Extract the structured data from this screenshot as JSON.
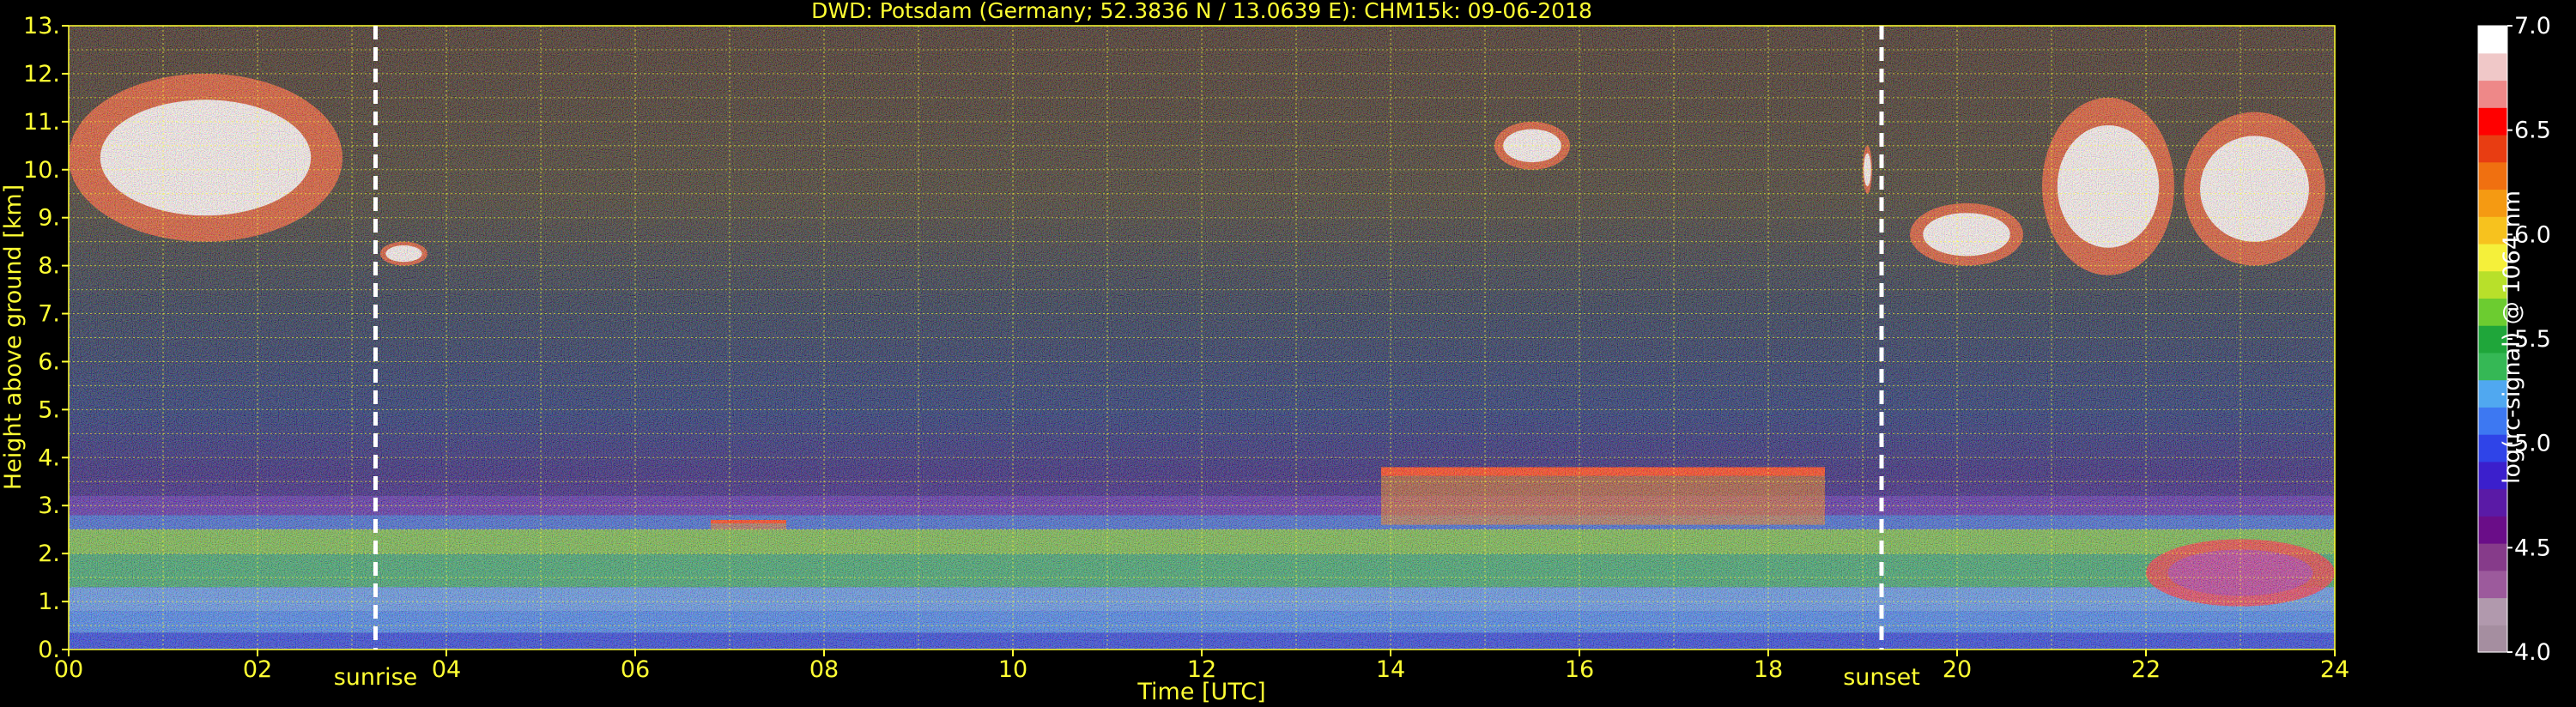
{
  "chart_data": {
    "type": "heatmap",
    "title": "DWD: Potsdam (Germany; 52.3836 N / 13.0639 E):    CHM15k: 09-06-2018",
    "xlabel": "Time [UTC]",
    "ylabel": "Height above ground [km]",
    "xlim": [
      0,
      24
    ],
    "ylim": [
      0,
      13
    ],
    "x_ticks": [
      "00",
      "02",
      "04",
      "06",
      "08",
      "10",
      "12",
      "14",
      "16",
      "18",
      "20",
      "22",
      "24"
    ],
    "y_ticks": [
      "0.",
      "1.",
      "2.",
      "3.",
      "4.",
      "5.",
      "6.",
      "7.",
      "8.",
      "9.",
      "10.",
      "11.",
      "12.",
      "13."
    ],
    "grid": true,
    "colorbar": {
      "label": "log(rc-signal) @ 1064 nm",
      "range": [
        4.0,
        7.0
      ],
      "ticks": [
        "4.0",
        "4.5",
        "5.0",
        "5.5",
        "6.0",
        "6.5",
        "7.0"
      ],
      "colors": [
        "#a58ea0",
        "#b199ad",
        "#9c5a9c",
        "#863b8a",
        "#6a0d88",
        "#5a1aa6",
        "#3b1fcc",
        "#2f44e8",
        "#3d78f2",
        "#50a8f0",
        "#35b855",
        "#1fa63a",
        "#6ccc30",
        "#b8e02a",
        "#f5f03a",
        "#f7c21e",
        "#f59a12",
        "#f07010",
        "#e83d12",
        "#ff0000",
        "#ee8888",
        "#f0c8c8",
        "#ffffff"
      ]
    },
    "annotations": [
      {
        "text": "sunrise",
        "x": 3.25
      },
      {
        "text": "sunset",
        "x": 19.2
      }
    ],
    "features": [
      {
        "kind": "cirrus",
        "x": [
          0.0,
          2.9
        ],
        "y": [
          8.5,
          12.0
        ]
      },
      {
        "kind": "cirrus",
        "x": [
          3.3,
          3.8
        ],
        "y": [
          8.0,
          8.5
        ]
      },
      {
        "kind": "cirrus",
        "x": [
          15.1,
          15.9
        ],
        "y": [
          10.0,
          11.0
        ]
      },
      {
        "kind": "cirrus",
        "x": [
          19.0,
          19.1
        ],
        "y": [
          9.5,
          10.5
        ]
      },
      {
        "kind": "cirrus",
        "x": [
          19.5,
          20.7
        ],
        "y": [
          8.0,
          9.3
        ]
      },
      {
        "kind": "cirrus",
        "x": [
          20.9,
          22.3
        ],
        "y": [
          7.8,
          11.5
        ]
      },
      {
        "kind": "cirrus",
        "x": [
          22.4,
          23.9
        ],
        "y": [
          8.0,
          11.2
        ]
      },
      {
        "kind": "cloud_base",
        "x": [
          6.8,
          7.6
        ],
        "y": [
          2.5,
          2.7
        ]
      },
      {
        "kind": "cloud_base",
        "x": [
          13.9,
          18.6
        ],
        "y": [
          2.6,
          3.8
        ]
      },
      {
        "kind": "boundary_layer",
        "x": [
          0,
          24
        ],
        "y": [
          0.0,
          3.2
        ]
      },
      {
        "kind": "residual_layer",
        "x": [
          22.0,
          24.0
        ],
        "y": [
          0.9,
          2.3
        ]
      }
    ]
  }
}
